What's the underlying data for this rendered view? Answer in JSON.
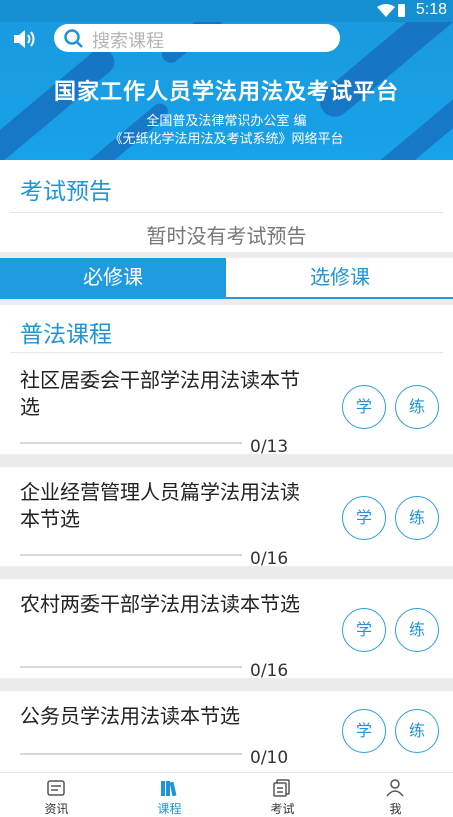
{
  "status_bar": {
    "time": "5:18"
  },
  "banner": {
    "search_placeholder": "搜索课程",
    "title": "国家工作人员学法用法及考试平台",
    "subtitle_1": "全国普及法律常识办公室 编",
    "subtitle_2": "《无纸化学法用法及考试系统》网络平台"
  },
  "exam_preview": {
    "title": "考试预告",
    "empty_text": "暂时没有考试预告"
  },
  "tabs": [
    {
      "label": "必修课",
      "active": true
    },
    {
      "label": "选修课",
      "active": false
    }
  ],
  "courses_section": {
    "title": "普法课程"
  },
  "courses": [
    {
      "name": "社区居委会干部学法用法读本节选",
      "progress": "0/13",
      "study_label": "学",
      "practice_label": "练"
    },
    {
      "name": "企业经营管理人员篇学法用法读本节选",
      "progress": "0/16",
      "study_label": "学",
      "practice_label": "练"
    },
    {
      "name": "农村两委干部学法用法读本节选",
      "progress": "0/16",
      "study_label": "学",
      "practice_label": "练"
    },
    {
      "name": "公务员学法用法读本节选",
      "progress": "0/10",
      "study_label": "学",
      "practice_label": "练"
    }
  ],
  "bottom_nav": [
    {
      "label": "资讯",
      "icon": "news-icon",
      "active": false
    },
    {
      "label": "课程",
      "icon": "books-icon",
      "active": true
    },
    {
      "label": "考试",
      "icon": "exam-paper-icon",
      "active": false
    },
    {
      "label": "我",
      "icon": "person-icon",
      "active": false
    }
  ],
  "colors": {
    "accent": "#1f95d8",
    "banner": "#1a9ae0"
  }
}
